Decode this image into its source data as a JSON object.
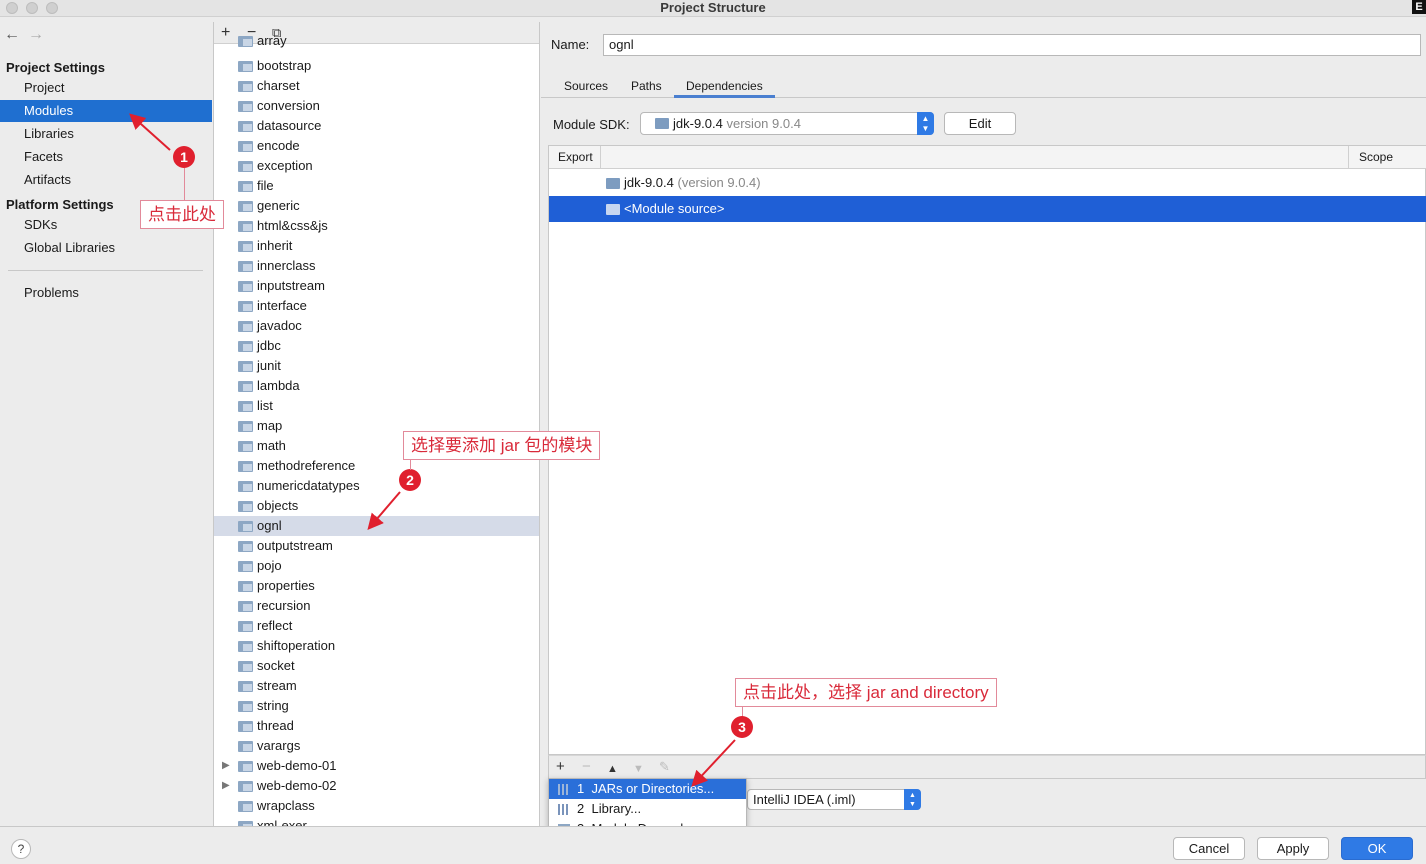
{
  "window": {
    "title": "Project Structure"
  },
  "leftnav": {
    "back_icon": "←",
    "forward_icon": "→",
    "project_settings_header": "Project Settings",
    "project_settings_items": [
      "Project",
      "Modules",
      "Libraries",
      "Facets",
      "Artifacts"
    ],
    "selected_item": "Modules",
    "platform_settings_header": "Platform Settings",
    "platform_settings_items": [
      "SDKs",
      "Global Libraries"
    ],
    "problems": "Problems"
  },
  "modules": {
    "toolbar": {
      "add": "+",
      "remove": "−",
      "copy": "⧉"
    },
    "partial_top": "array",
    "items": [
      "bootstrap",
      "charset",
      "conversion",
      "datasource",
      "encode",
      "exception",
      "file",
      "generic",
      "html&css&js",
      "inherit",
      "innerclass",
      "inputstream",
      "interface",
      "javadoc",
      "jdbc",
      "junit",
      "lambda",
      "list",
      "map",
      "math",
      "methodreference",
      "numericdatatypes",
      "objects",
      "ognl",
      "outputstream",
      "pojo",
      "properties",
      "recursion",
      "reflect",
      "shiftoperation",
      "socket",
      "stream",
      "string",
      "thread",
      "varargs",
      "web-demo-01",
      "web-demo-02",
      "wrapclass"
    ],
    "selected": "ognl",
    "expandable": [
      "web-demo-01",
      "web-demo-02"
    ],
    "partial_bottom": "xml-exer"
  },
  "detail": {
    "name_label": "Name:",
    "name_value": "ognl",
    "tabs": [
      "Sources",
      "Paths",
      "Dependencies"
    ],
    "active_tab": "Dependencies",
    "sdk_label": "Module SDK:",
    "sdk_name": "jdk-9.0.4",
    "sdk_version": "version 9.0.4",
    "edit_button": "Edit",
    "table_headers": {
      "export": "Export",
      "scope": "Scope"
    },
    "deps": [
      {
        "name": "jdk-9.0.4",
        "extra": "(version 9.0.4)"
      },
      {
        "name": "<Module source>",
        "extra": ""
      }
    ],
    "storage_format": "IntelliJ IDEA (.iml)"
  },
  "dep_toolbar": {
    "add": "+",
    "remove": "−",
    "up": "▲",
    "down": "▼",
    "edit": "✎"
  },
  "popup": {
    "items": [
      {
        "num": "1",
        "label": "JARs or Directories..."
      },
      {
        "num": "2",
        "label": "Library..."
      },
      {
        "num": "3",
        "label": "Module Dependency..."
      }
    ]
  },
  "buttons": {
    "help": "?",
    "cancel": "Cancel",
    "apply": "Apply",
    "ok": "OK"
  },
  "annotations": [
    {
      "num": "1",
      "text": "点击此处"
    },
    {
      "num": "2",
      "text": "选择要添加 jar 包的模块"
    },
    {
      "num": "3",
      "text": "点击此处，选择 jar and directory"
    }
  ],
  "colors": {
    "selection": "#1f6fd0",
    "annotation_red": "#e0202e",
    "primary_button": "#2f7ae5"
  }
}
